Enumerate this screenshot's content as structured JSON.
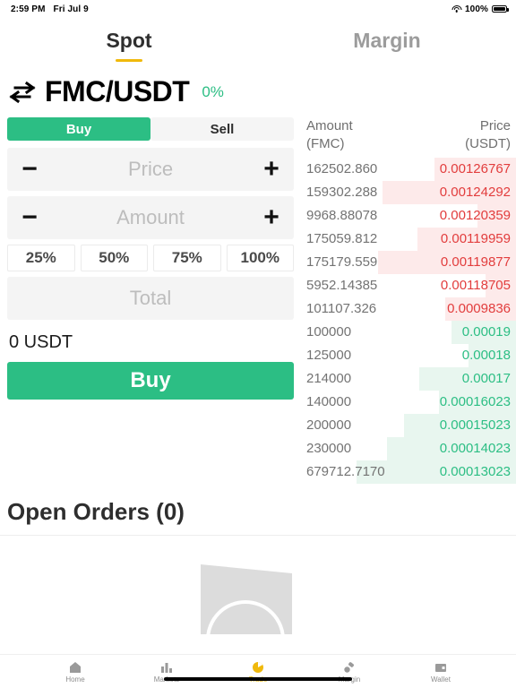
{
  "status_bar": {
    "time": "2:59 PM",
    "date": "Fri Jul 9",
    "battery_percent": "100%",
    "wifi_icon": "wifi-icon",
    "battery_icon": "battery-icon"
  },
  "tabs": {
    "items": [
      {
        "label": "Spot",
        "active": true
      },
      {
        "label": "Margin",
        "active": false
      }
    ]
  },
  "pair": {
    "swap_icon": "swap-arrows-icon",
    "symbol": "FMC/USDT",
    "change": "0%",
    "change_color": "#2cbe84"
  },
  "order_form": {
    "side_buy": "Buy",
    "side_sell": "Sell",
    "active_side": "Buy",
    "price_placeholder": "Price",
    "price_value": "",
    "amount_placeholder": "Amount",
    "amount_value": "",
    "total_placeholder": "Total",
    "total_value": "",
    "minus_icon": "minus-icon",
    "plus_icon": "plus-icon",
    "percents": [
      "25%",
      "50%",
      "75%",
      "100%"
    ],
    "balance": "0 USDT",
    "submit_label": "Buy",
    "accent_green": "#2cbe84"
  },
  "order_book": {
    "header": {
      "amount_line1": "Amount",
      "amount_line2": "(FMC)",
      "price_line1": "Price",
      "price_line2": "(USDT)"
    },
    "ask_color": "#e23d3d",
    "bid_color": "#2cbe84",
    "asks": [
      {
        "amount": "162502.860",
        "price": "0.00126767",
        "depth": 38
      },
      {
        "amount": "159302.288",
        "price": "0.00124292",
        "depth": 62
      },
      {
        "amount": "9968.88078",
        "price": "0.00120359",
        "depth": 18
      },
      {
        "amount": "175059.812",
        "price": "0.00119959",
        "depth": 46
      },
      {
        "amount": "175179.559",
        "price": "0.00119877",
        "depth": 64
      },
      {
        "amount": "5952.14385",
        "price": "0.00118705",
        "depth": 14
      },
      {
        "amount": "101107.326",
        "price": "0.0009836",
        "depth": 33
      }
    ],
    "bids": [
      {
        "amount": "100000",
        "price": "0.00019",
        "depth": 30
      },
      {
        "amount": "125000",
        "price": "0.00018",
        "depth": 22
      },
      {
        "amount": "214000",
        "price": "0.00017",
        "depth": 45
      },
      {
        "amount": "140000",
        "price": "0.00016023",
        "depth": 36
      },
      {
        "amount": "200000",
        "price": "0.00015023",
        "depth": 52
      },
      {
        "amount": "230000",
        "price": "0.00014023",
        "depth": 60
      },
      {
        "amount": "679712.7170",
        "price": "0.00013023",
        "depth": 74
      }
    ]
  },
  "open_orders": {
    "title": "Open Orders (0)",
    "empty_illustration": "empty-state-illustration"
  },
  "tabbar": {
    "items": [
      {
        "label": "Home",
        "icon": "home-icon",
        "active": false
      },
      {
        "label": "Markets",
        "icon": "bar-chart-icon",
        "active": false
      },
      {
        "label": "Trade",
        "icon": "trade-pie-icon",
        "active": true
      },
      {
        "label": "Margin",
        "icon": "margin-icon",
        "active": false
      },
      {
        "label": "Wallet",
        "icon": "wallet-icon",
        "active": false
      }
    ],
    "active_color": "#f0b90b"
  }
}
